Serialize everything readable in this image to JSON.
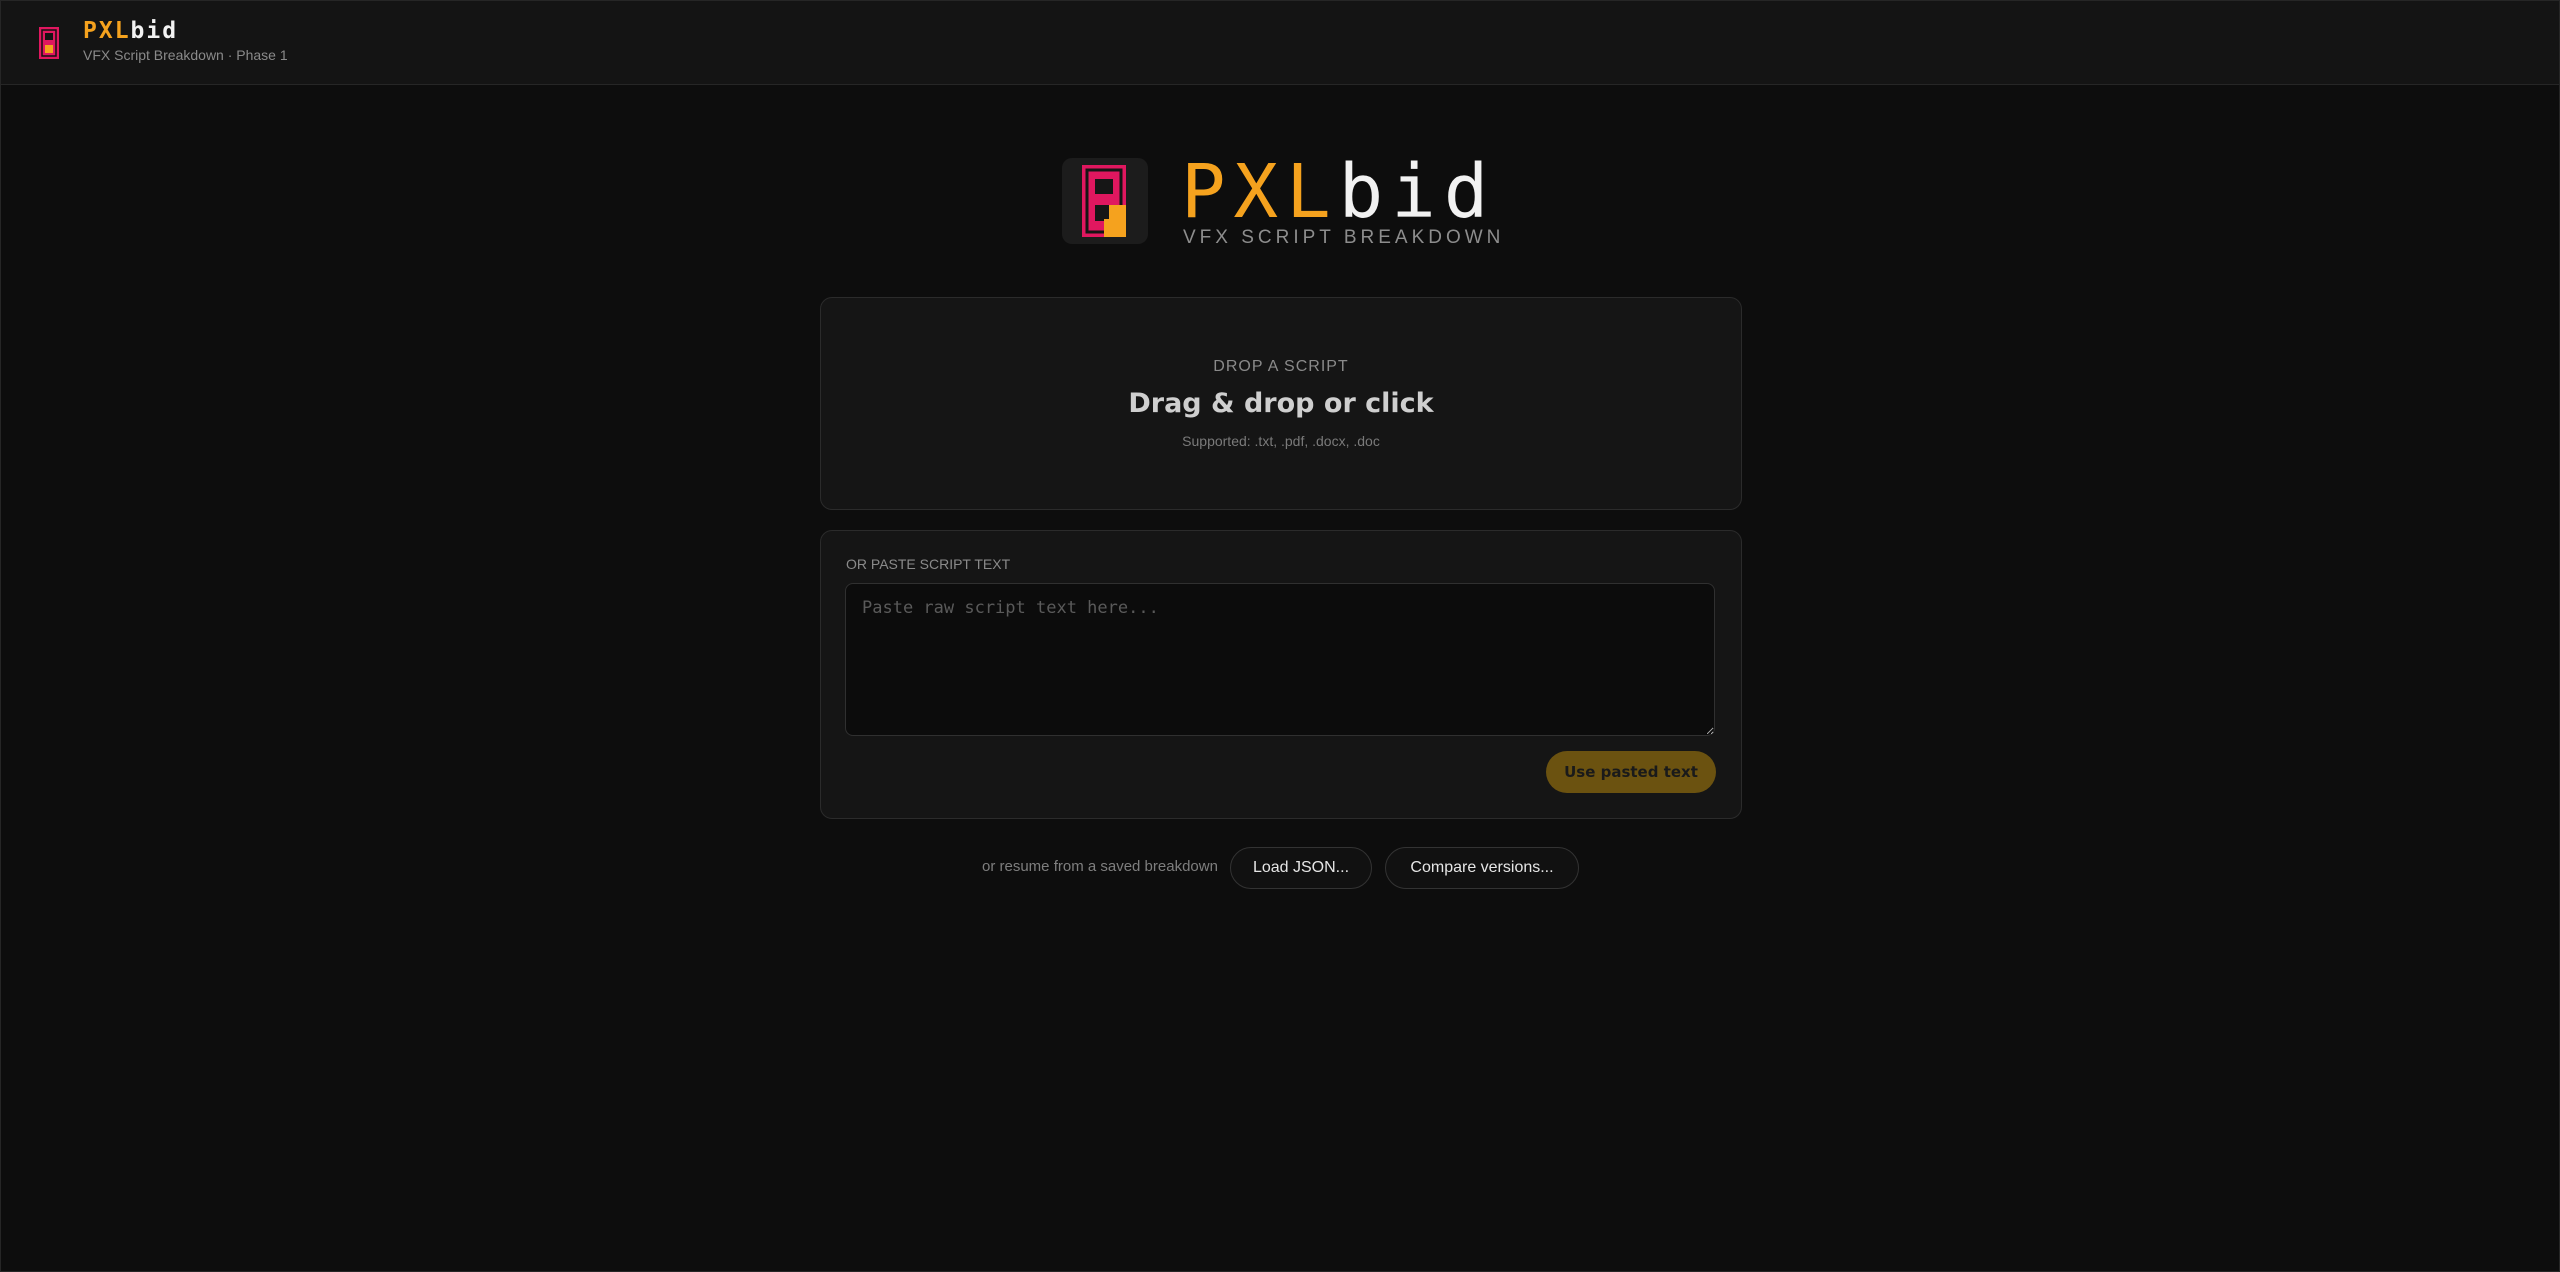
{
  "header": {
    "brand_primary": "PXL",
    "brand_secondary": "bid",
    "subtitle": "VFX Script Breakdown · Phase 1"
  },
  "hero": {
    "brand_primary": "PXL",
    "brand_secondary": "bid",
    "tagline": "VFX SCRIPT BREAKDOWN"
  },
  "dropzone": {
    "kicker": "DROP A SCRIPT",
    "title": "Drag & drop or click",
    "supported": "Supported: .txt, .pdf, .docx, .doc"
  },
  "paste": {
    "label": "OR PASTE SCRIPT TEXT",
    "placeholder": "Paste raw script text here...",
    "value": "",
    "submit_label": "Use pasted text"
  },
  "resume": {
    "text": "or resume from a saved breakdown",
    "load_label": "Load JSON...",
    "compare_label": "Compare versions..."
  },
  "icons": {
    "logo": "pxlbid-logo-icon"
  },
  "colors": {
    "background": "#0d0d0d",
    "accent_orange": "#f5a21e",
    "logo_pink": "#e0175f",
    "button_gold": "#6b5210"
  }
}
